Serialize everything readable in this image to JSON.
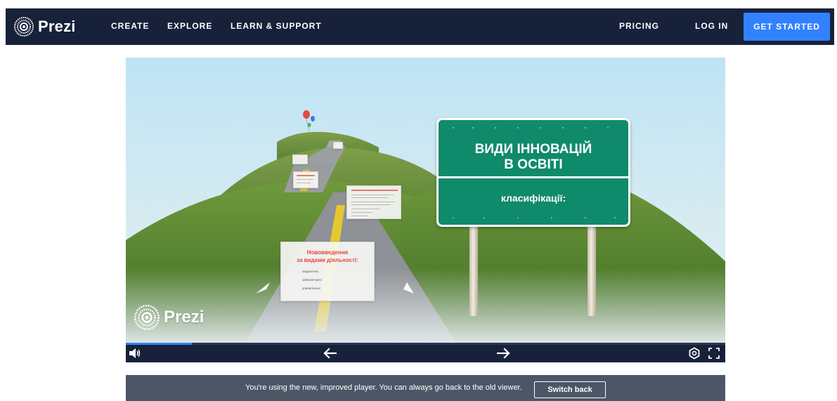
{
  "brand": {
    "name": "Prezi"
  },
  "nav": {
    "create": "CREATE",
    "explore": "EXPLORE",
    "learn_support": "LEARN & SUPPORT",
    "pricing": "PRICING",
    "login": "LOG IN",
    "get_started": "GET STARTED"
  },
  "presentation": {
    "sign_title_line1": "ВИДИ ІННОВАЦІЙ",
    "sign_title_line2": "В ОСВІТІ",
    "sign_subtitle": "класифікації:",
    "card_main": {
      "title_line1": "Нововведення",
      "title_line2": "за видами діяльності:",
      "items": [
        "педагогічні",
        "забезпечуючі",
        "управлінські"
      ]
    },
    "watermark": "Prezi"
  },
  "player": {
    "progress": 0.11,
    "icons": {
      "volume": "volume-icon",
      "prev": "arrow-left-icon",
      "next": "arrow-right-icon",
      "settings": "settings-icon",
      "fullscreen": "fullscreen-icon"
    }
  },
  "notice": {
    "message": "You're using the new, improved player. You can always go back to the old viewer.",
    "switch_back": "Switch back"
  },
  "colors": {
    "nav_bg": "#17213a",
    "accent": "#3181ff",
    "sign_green": "#0f8a6b",
    "notice_bg": "#4c5667",
    "card_title_red": "#e5483c"
  }
}
